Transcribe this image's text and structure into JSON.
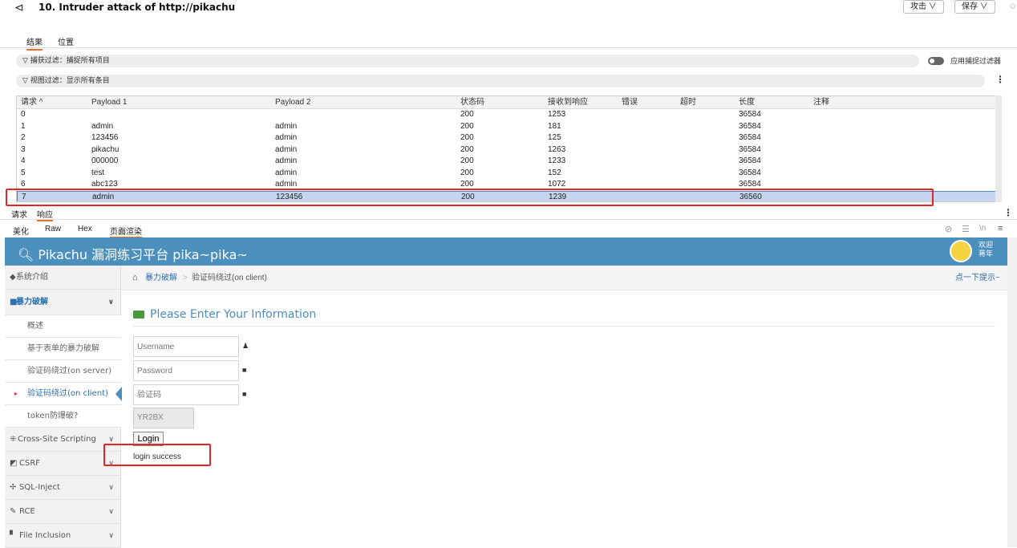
{
  "titlebar": {
    "title": "10. Intruder attack of http://pikachu",
    "attack_btn": "攻击 ∨",
    "save_btn": "保存 ∨"
  },
  "tabs_top": [
    "结果",
    "位置"
  ],
  "capture_filter": {
    "label": "捕获过滤：捕捉所有项目",
    "toggle_label": "应用捕捉过滤器"
  },
  "view_filter": {
    "label": "视图过滤：显示所有条目"
  },
  "table": {
    "headers": [
      "请求 ^",
      "Payload 1",
      "Payload 2",
      "状态码",
      "接收到响应",
      "错误",
      "超时",
      "长度",
      "注释"
    ],
    "rows": [
      [
        "0",
        "",
        "",
        "200",
        "1253",
        "",
        "",
        "36584",
        ""
      ],
      [
        "1",
        "admin",
        "admin",
        "200",
        "181",
        "",
        "",
        "36584",
        ""
      ],
      [
        "2",
        "123456",
        "admin",
        "200",
        "125",
        "",
        "",
        "36584",
        ""
      ],
      [
        "3",
        "pikachu",
        "admin",
        "200",
        "1263",
        "",
        "",
        "36584",
        ""
      ],
      [
        "4",
        "000000",
        "admin",
        "200",
        "1233",
        "",
        "",
        "36584",
        ""
      ],
      [
        "5",
        "test",
        "admin",
        "200",
        "152",
        "",
        "",
        "36584",
        ""
      ],
      [
        "6",
        "abc123",
        "admin",
        "200",
        "1072",
        "",
        "",
        "36584",
        ""
      ],
      [
        "7",
        "admin",
        "123456",
        "200",
        "1239",
        "",
        "",
        "36560",
        ""
      ]
    ]
  },
  "detail_tabs": [
    "请求",
    "响应"
  ],
  "view_tabs": [
    "美化",
    "Raw",
    "Hex",
    "页面渲染"
  ],
  "pikachu": {
    "title": "Pikachu 漏洞练习平台 pika~pika~",
    "welcome_line1": "欢迎",
    "welcome_line2": "蒋年",
    "sidebar": {
      "intro": "系统介绍",
      "brute": "暴力破解",
      "sub": [
        "概述",
        "基于表单的暴力破解",
        "验证码绕过(on server)",
        "验证码绕过(on client)",
        "token防爆破?"
      ],
      "xss": "Cross-Site Scripting",
      "csrf": "CSRF",
      "sqli": "SQL-Inject",
      "rce": "RCE",
      "fi": "File Inclusion"
    },
    "crumb": {
      "parent": "暴力破解",
      "sep": ">",
      "current": "验证码绕过(on client)",
      "hint": "点一下提示~"
    },
    "form": {
      "heading": "Please Enter Your Information",
      "username_ph": "Username",
      "password_ph": "Password",
      "captcha_ph": "验证码",
      "captcha_code": "YR2BX",
      "login_btn": "Login",
      "result": "login success"
    }
  },
  "colors": {
    "header_blue": "#4b8fbd",
    "highlight": "#e0262a",
    "accent": "#e8722c",
    "selected_row": "#c5d5ee"
  }
}
